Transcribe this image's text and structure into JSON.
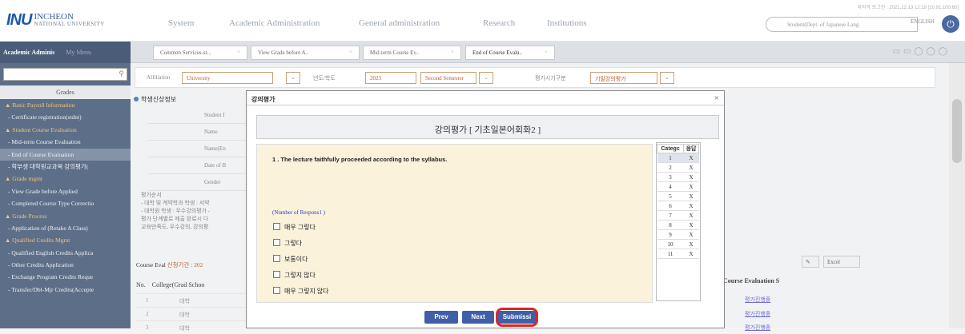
{
  "header": {
    "logo_mark": "INU",
    "logo_name": "INCHEON",
    "logo_sub": "NATIONAL UNIVERSITY",
    "nav": [
      "System",
      "Academic Administration",
      "General administration",
      "Research",
      "Institutions"
    ],
    "last_login": "마지막 로그인 : 2021.12.13 12:19 [10.91.100.60]",
    "role": "Student(Dept. of Japanese Lang",
    "lang": "ENGLISH"
  },
  "sidebar": {
    "tab_active": "Academic Adminis",
    "tab_other": "My Menu",
    "section": "Grades",
    "items": [
      {
        "label": "▲ Basic Payroll Information",
        "t": "head"
      },
      {
        "label": "- Certificate registration(stdnt)",
        "t": "sub"
      },
      {
        "label": "▲ Student Course Evaluation",
        "t": "head"
      },
      {
        "label": "- Mid-term Course Evaluation",
        "t": "sub"
      },
      {
        "label": "- End of Course Evaluation",
        "t": "sel"
      },
      {
        "label": "- 학부생 대학원교과목 강의평가(",
        "t": "sub"
      },
      {
        "label": "▲ Grade mgmt",
        "t": "head"
      },
      {
        "label": "- View Grade before Applied",
        "t": "sub"
      },
      {
        "label": "- Completed Course Type Correctio",
        "t": "sub"
      },
      {
        "label": "▲ Grade Process",
        "t": "head"
      },
      {
        "label": "- Application of (Retake A Class)",
        "t": "sub"
      },
      {
        "label": "▲ Qualified Credits Mgmt",
        "t": "head"
      },
      {
        "label": "- Qualified English Credits Applica",
        "t": "sub"
      },
      {
        "label": "- Other Credits Application",
        "t": "sub"
      },
      {
        "label": "- Exchange Program Credits Reque",
        "t": "sub"
      },
      {
        "label": "- Transfer/Dbl-Mjr Credits(Accepte",
        "t": "sub"
      }
    ]
  },
  "tabs": [
    "Common Services-st...",
    "View Grade before A..",
    "Mid-term Course Ev..",
    "End of Course Evalu.."
  ],
  "filter": {
    "affiliation_label": "Affiliation",
    "affiliation": "University",
    "year_label": "년도/학도",
    "year": "2023",
    "semester": "Second Semester",
    "period_label": "평가시기구분",
    "period": "기말강의평가"
  },
  "student": {
    "title": "학생신상정보",
    "rows": [
      "Student I",
      "Name",
      "Name(En",
      "Date of B",
      "Gender"
    ]
  },
  "notice": {
    "lines": [
      "평가순서",
      "- 대학 및 계약학과 학생 : 서약",
      "- 대학원 학생 : 우수강의평가 -",
      "",
      "평가 단계별로 제출 완료시 다",
      "교육만족도, 우수강의, 강의평"
    ]
  },
  "course_eval": {
    "label": "Course Eval",
    "period": "신청기간 : 202",
    "head_no": "No.",
    "head_college": "College(Grad Schoo",
    "rows": [
      {
        "no": "1",
        "college": "대학"
      },
      {
        "no": "2",
        "college": "대학"
      },
      {
        "no": "3",
        "college": "대학"
      }
    ],
    "excel": "Excel",
    "right_head": "Course Evaluation S",
    "status": [
      "평가진행중",
      "평가진행중",
      "평가진행중"
    ]
  },
  "modal": {
    "title": "강의평가",
    "header": "강의평가 [ 기초일본어회화2 ]",
    "question": "1 . The lecture faithfully proceeded according to the syllabus.",
    "resp_count": "(Number of Respons1 )",
    "options": [
      "매우 그렇다",
      "그렇다",
      "보통이다",
      "그렇지 않다",
      "매우 그렇지 않다"
    ],
    "cat_head": "Categc",
    "resp_head": "응답",
    "cat_rows": [
      {
        "c": "1",
        "r": "X"
      },
      {
        "c": "2",
        "r": "X"
      },
      {
        "c": "3",
        "r": "X"
      },
      {
        "c": "4",
        "r": "X"
      },
      {
        "c": "5",
        "r": "X"
      },
      {
        "c": "6",
        "r": "X"
      },
      {
        "c": "7",
        "r": "X"
      },
      {
        "c": "8",
        "r": "X"
      },
      {
        "c": "9",
        "r": "X"
      },
      {
        "c": "10",
        "r": "X"
      },
      {
        "c": "11",
        "r": "X"
      }
    ],
    "prev": "Prev",
    "next": "Next",
    "submit": "Submissi"
  }
}
